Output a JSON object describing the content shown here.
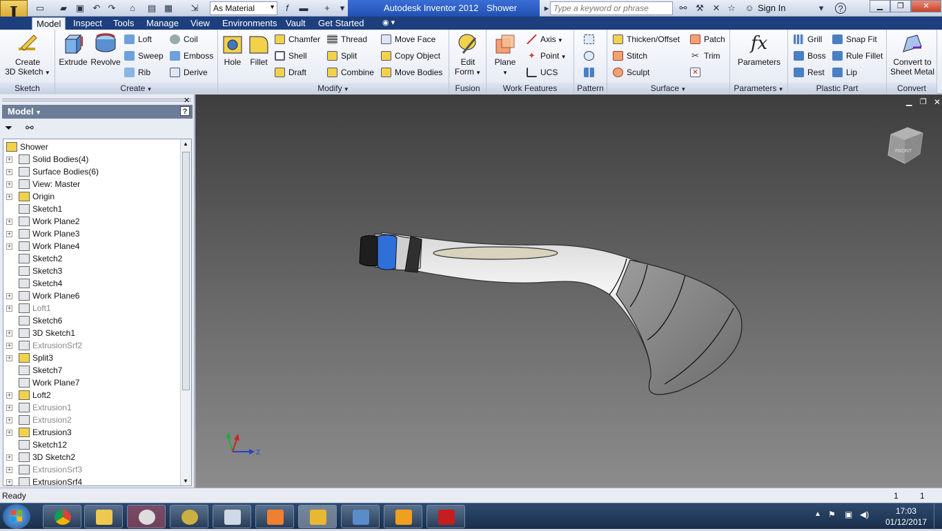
{
  "app_letter": "I",
  "titlebar": {
    "material": "As Material",
    "app_name": "Autodesk Inventor 2012",
    "doc_name": "Shower",
    "search_placeholder": "Type a keyword or phrase",
    "sign_in": "Sign In"
  },
  "tabs": [
    "Model",
    "Inspect",
    "Tools",
    "Manage",
    "View",
    "Environments",
    "Vault",
    "Get Started"
  ],
  "ribbon": {
    "sketch": {
      "label": "Sketch",
      "create_3d_line1": "Create",
      "create_3d_line2": "3D Sketch"
    },
    "create": {
      "label": "Create",
      "extrude": "Extrude",
      "revolve": "Revolve",
      "loft": "Loft",
      "sweep": "Sweep",
      "rib": "Rib",
      "coil": "Coil",
      "emboss": "Emboss",
      "derive": "Derive"
    },
    "modify": {
      "label": "Modify",
      "hole": "Hole",
      "fillet": "Fillet",
      "chamfer": "Chamfer",
      "shell": "Shell",
      "draft": "Draft",
      "thread": "Thread",
      "split": "Split",
      "combine": "Combine",
      "move_face": "Move Face",
      "copy_object": "Copy Object",
      "move_bodies": "Move Bodies"
    },
    "fusion": {
      "label": "Fusion",
      "edit_form_line1": "Edit",
      "edit_form_line2": "Form"
    },
    "work_features": {
      "label": "Work Features",
      "plane": "Plane",
      "axis": "Axis",
      "point": "Point",
      "ucs": "UCS"
    },
    "pattern": {
      "label": "Pattern"
    },
    "surface": {
      "label": "Surface",
      "thicken": "Thicken/Offset",
      "stitch": "Stitch",
      "sculpt": "Sculpt",
      "patch": "Patch",
      "trim": "Trim"
    },
    "parameters": {
      "label": "Parameters",
      "parameters": "Parameters",
      "fx": "fx"
    },
    "plastic_part": {
      "label": "Plastic Part",
      "grill": "Grill",
      "boss": "Boss",
      "rest": "Rest",
      "snap_fit": "Snap Fit",
      "rule_fillet": "Rule Fillet",
      "lip": "Lip"
    },
    "convert": {
      "label": "Convert",
      "sheet_metal_line1": "Convert to",
      "sheet_metal_line2": "Sheet Metal"
    }
  },
  "browser": {
    "title": "Model",
    "help": "?",
    "items": [
      {
        "label": "Shower",
        "dim": false,
        "expander": false
      },
      {
        "label": "Solid Bodies(4)",
        "dim": false,
        "expander": true
      },
      {
        "label": "Surface Bodies(6)",
        "dim": false,
        "expander": true
      },
      {
        "label": "View: Master",
        "dim": false,
        "expander": true
      },
      {
        "label": "Origin",
        "dim": false,
        "expander": true
      },
      {
        "label": "Sketch1",
        "dim": false,
        "expander": false
      },
      {
        "label": "Work Plane2",
        "dim": false,
        "expander": true
      },
      {
        "label": "Work Plane3",
        "dim": false,
        "expander": true
      },
      {
        "label": "Work Plane4",
        "dim": false,
        "expander": true
      },
      {
        "label": "Sketch2",
        "dim": false,
        "expander": false
      },
      {
        "label": "Sketch3",
        "dim": false,
        "expander": false
      },
      {
        "label": "Sketch4",
        "dim": false,
        "expander": false
      },
      {
        "label": "Work Plane6",
        "dim": false,
        "expander": true
      },
      {
        "label": "Loft1",
        "dim": true,
        "expander": true
      },
      {
        "label": "Sketch6",
        "dim": false,
        "expander": false
      },
      {
        "label": "3D Sketch1",
        "dim": false,
        "expander": true
      },
      {
        "label": "ExtrusionSrf2",
        "dim": true,
        "expander": true
      },
      {
        "label": "Split3",
        "dim": false,
        "expander": true
      },
      {
        "label": "Sketch7",
        "dim": false,
        "expander": false
      },
      {
        "label": "Work Plane7",
        "dim": false,
        "expander": false
      },
      {
        "label": "Loft2",
        "dim": false,
        "expander": true
      },
      {
        "label": "Extrusion1",
        "dim": true,
        "expander": true
      },
      {
        "label": "Extrusion2",
        "dim": true,
        "expander": true
      },
      {
        "label": "Extrusion3",
        "dim": false,
        "expander": true
      },
      {
        "label": "Sketch12",
        "dim": false,
        "expander": false
      },
      {
        "label": "3D Sketch2",
        "dim": false,
        "expander": true
      },
      {
        "label": "ExtrusionSrf3",
        "dim": true,
        "expander": true
      },
      {
        "label": "ExtrusionSrf4",
        "dim": false,
        "expander": true
      }
    ]
  },
  "viewport": {
    "viewcube_label": "FRONT",
    "triad_z": "Z"
  },
  "status": {
    "text": "Ready",
    "count_a": "1",
    "count_b": "1"
  },
  "taskbar": {
    "time": "17:03",
    "date": "01/12/2017"
  },
  "colors": {
    "accent": "#2150b0",
    "tab_bar": "#1d3f7e",
    "viewport_top": "#3e3e3e",
    "viewport_bottom": "#8c8c8c"
  }
}
